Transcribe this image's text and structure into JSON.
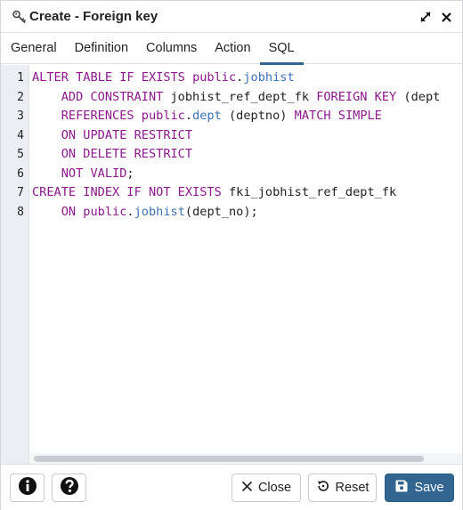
{
  "window": {
    "title": "Create - Foreign key",
    "icon": "key-icon",
    "controls": [
      "expand-icon",
      "close-icon"
    ]
  },
  "tabs": [
    {
      "label": "General",
      "active": false
    },
    {
      "label": "Definition",
      "active": false
    },
    {
      "label": "Columns",
      "active": false
    },
    {
      "label": "Action",
      "active": false
    },
    {
      "label": "SQL",
      "active": true
    }
  ],
  "editor": {
    "line_numbers": [
      "1",
      "2",
      "3",
      "4",
      "5",
      "6",
      "7",
      "8"
    ],
    "lines": [
      [
        {
          "t": "ALTER TABLE IF EXISTS ",
          "c": "kw"
        },
        {
          "t": "public",
          "c": "kw"
        },
        {
          "t": ".",
          "c": "punct"
        },
        {
          "t": "jobhist",
          "c": "tbl"
        }
      ],
      [
        {
          "t": "    ADD CONSTRAINT ",
          "c": "kw"
        },
        {
          "t": "jobhist_ref_dept_fk ",
          "c": "ident"
        },
        {
          "t": "FOREIGN KEY ",
          "c": "kw"
        },
        {
          "t": "(dept",
          "c": "ident"
        }
      ],
      [
        {
          "t": "    REFERENCES ",
          "c": "kw"
        },
        {
          "t": "public",
          "c": "kw"
        },
        {
          "t": ".",
          "c": "punct"
        },
        {
          "t": "dept ",
          "c": "tbl"
        },
        {
          "t": "(deptno) ",
          "c": "ident"
        },
        {
          "t": "MATCH SIMPLE",
          "c": "kw"
        }
      ],
      [
        {
          "t": "    ON UPDATE RESTRICT",
          "c": "kw"
        }
      ],
      [
        {
          "t": "    ON DELETE RESTRICT",
          "c": "kw"
        }
      ],
      [
        {
          "t": "    NOT VALID",
          "c": "kw"
        },
        {
          "t": ";",
          "c": "punct"
        }
      ],
      [
        {
          "t": "CREATE INDEX IF NOT EXISTS ",
          "c": "kw"
        },
        {
          "t": "fki_jobhist_ref_dept_fk",
          "c": "ident"
        }
      ],
      [
        {
          "t": "    ON ",
          "c": "kw"
        },
        {
          "t": "public",
          "c": "kw"
        },
        {
          "t": ".",
          "c": "punct"
        },
        {
          "t": "jobhist",
          "c": "tbl"
        },
        {
          "t": "(dept_no);",
          "c": "ident"
        }
      ]
    ]
  },
  "footer": {
    "info_icon": "info-icon",
    "help_icon": "help-icon",
    "close_label": "Close",
    "reset_label": "Reset",
    "save_label": "Save"
  },
  "colors": {
    "accent": "#326690",
    "keyword": "#8a1a8a",
    "table_name": "#3d72b5",
    "gutter_bg": "#ebeef3"
  }
}
